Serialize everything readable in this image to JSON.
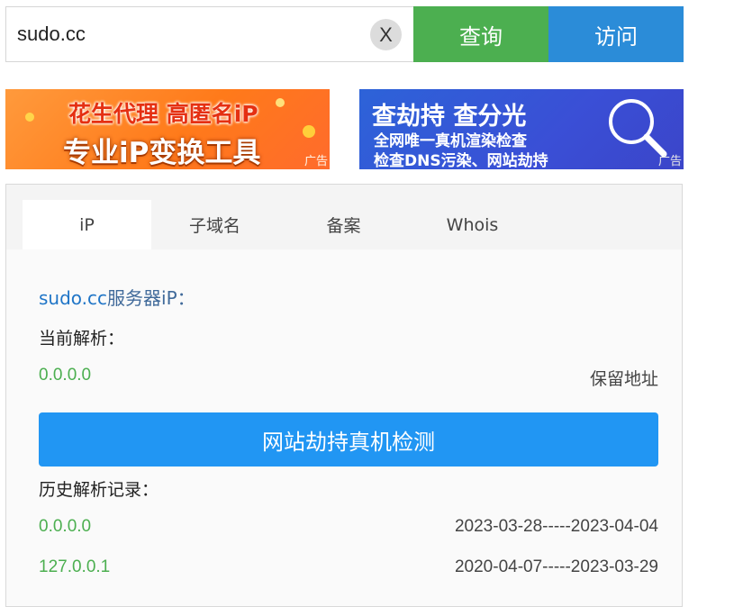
{
  "search": {
    "value": "sudo.cc",
    "clear_label": "X",
    "query_label": "查询",
    "visit_label": "访问"
  },
  "ads": [
    {
      "line1": "花生代理 高匿名iP",
      "line2": "专业iP变换工具",
      "badge": "广告"
    },
    {
      "line1": "查劫持 查分光",
      "line2": "全网唯一真机渲染检查",
      "line3": "检查DNS污染、网站劫持",
      "badge": "广告"
    }
  ],
  "tabs": [
    {
      "label": "iP",
      "active": true
    },
    {
      "label": "子域名",
      "active": false
    },
    {
      "label": "备案",
      "active": false
    },
    {
      "label": "Whois",
      "active": false
    }
  ],
  "content": {
    "title_domain": "sudo.cc",
    "title_suffix": "服务器iP：",
    "current_label": "当前解析：",
    "current_ip": "0.0.0.0",
    "current_note": "保留地址",
    "detect_button": "网站劫持真机检测",
    "history_label": "历史解析记录：",
    "history": [
      {
        "ip": "0.0.0.0",
        "range": "2023-03-28-----2023-04-04"
      },
      {
        "ip": "127.0.0.1",
        "range": "2020-04-07-----2023-03-29"
      }
    ]
  },
  "colors": {
    "query_green": "#4caf50",
    "visit_blue": "#2b8cd8",
    "detect_blue": "#2196f3",
    "ip_green": "#4caf50",
    "link_blue": "#1f75c7"
  }
}
